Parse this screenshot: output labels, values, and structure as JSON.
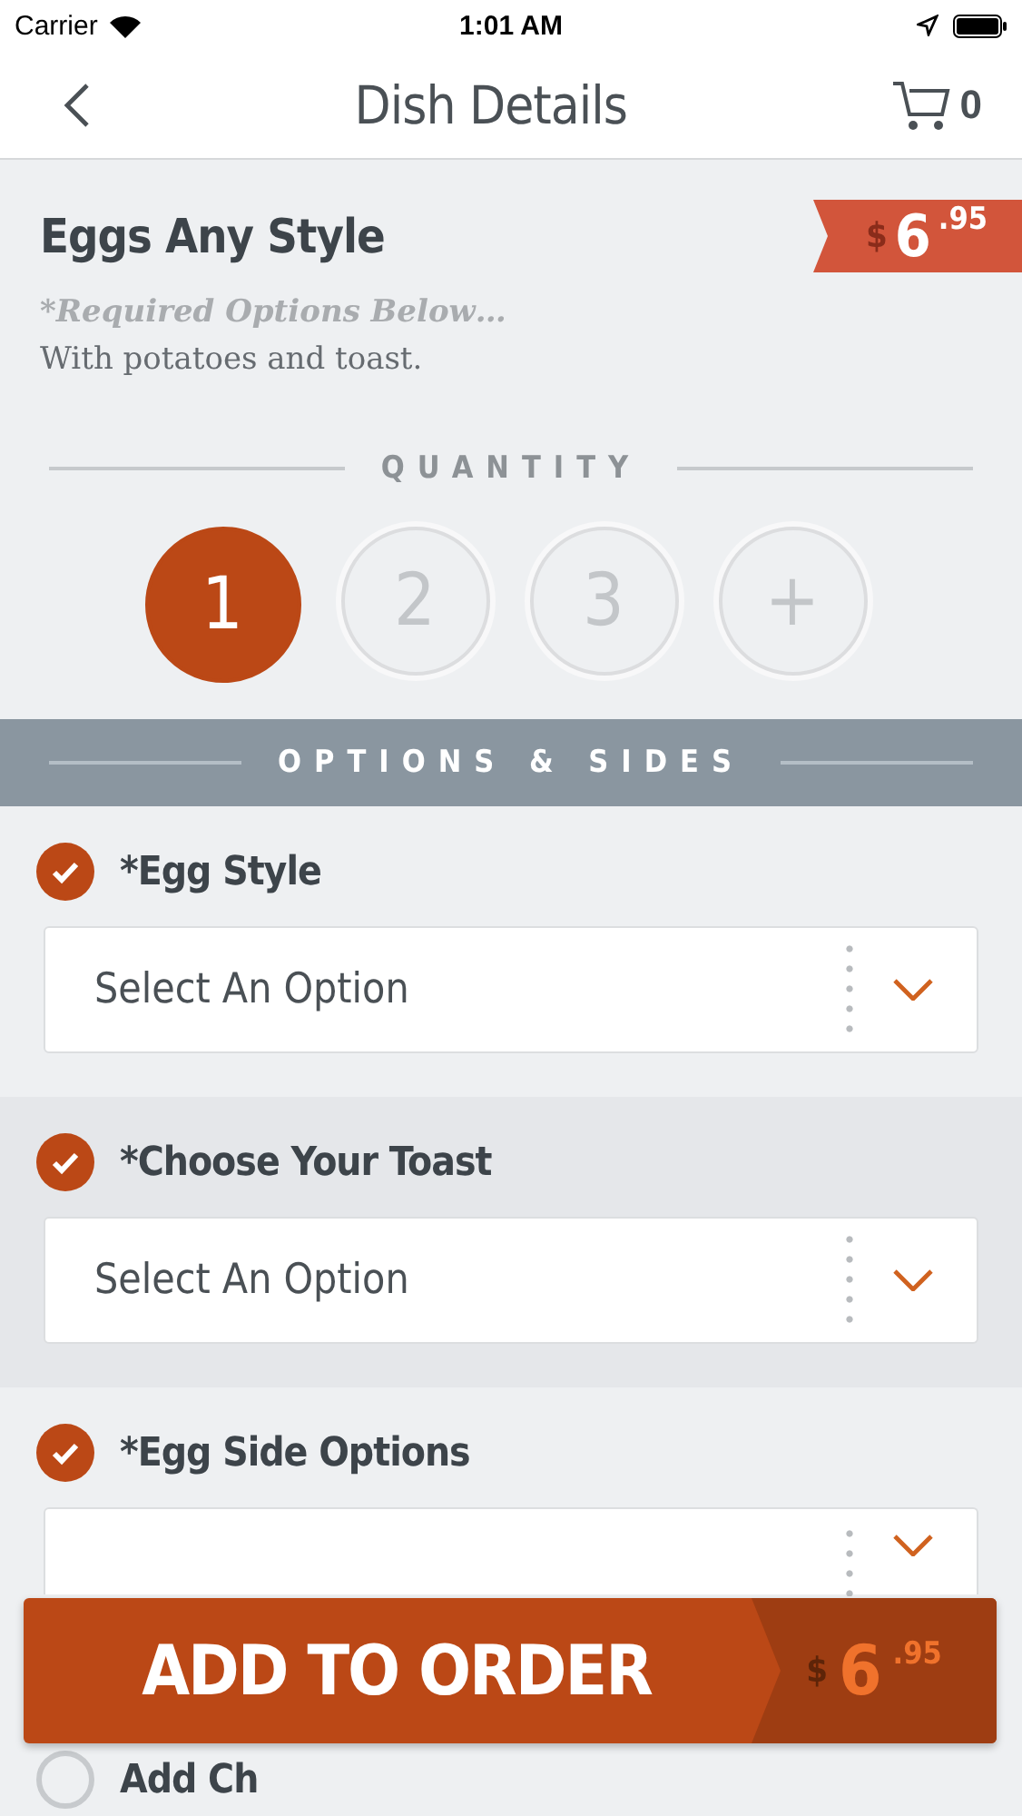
{
  "status_bar": {
    "carrier": "Carrier",
    "time": "1:01 AM"
  },
  "nav": {
    "title": "Dish Details",
    "cart_count": "0"
  },
  "dish": {
    "name": "Eggs Any Style",
    "price": {
      "currency": "$",
      "whole": "6",
      "cents": ".95"
    },
    "required_note": "*Required Options Below…",
    "description": "With potatoes and toast."
  },
  "quantity": {
    "label": "QUANTITY",
    "options": [
      {
        "label": "1",
        "selected": true
      },
      {
        "label": "2",
        "selected": false
      },
      {
        "label": "3",
        "selected": false
      },
      {
        "label": "+",
        "selected": false
      }
    ]
  },
  "options_header": "OPTIONS & SIDES",
  "option_groups": [
    {
      "kind": "select",
      "label": "*Egg Style",
      "checked": true,
      "placeholder": "Select An Option"
    },
    {
      "kind": "select",
      "label": "*Choose Your Toast",
      "checked": true,
      "placeholder": "Select An Option"
    },
    {
      "kind": "select",
      "label": "*Egg Side Options",
      "checked": true
    },
    {
      "kind": "toggle",
      "label": "Add Ch",
      "checked": false
    }
  ],
  "add_button": {
    "label": "ADD TO ORDER",
    "price": {
      "currency": "$",
      "whole": "6",
      "cents": ".95"
    }
  }
}
